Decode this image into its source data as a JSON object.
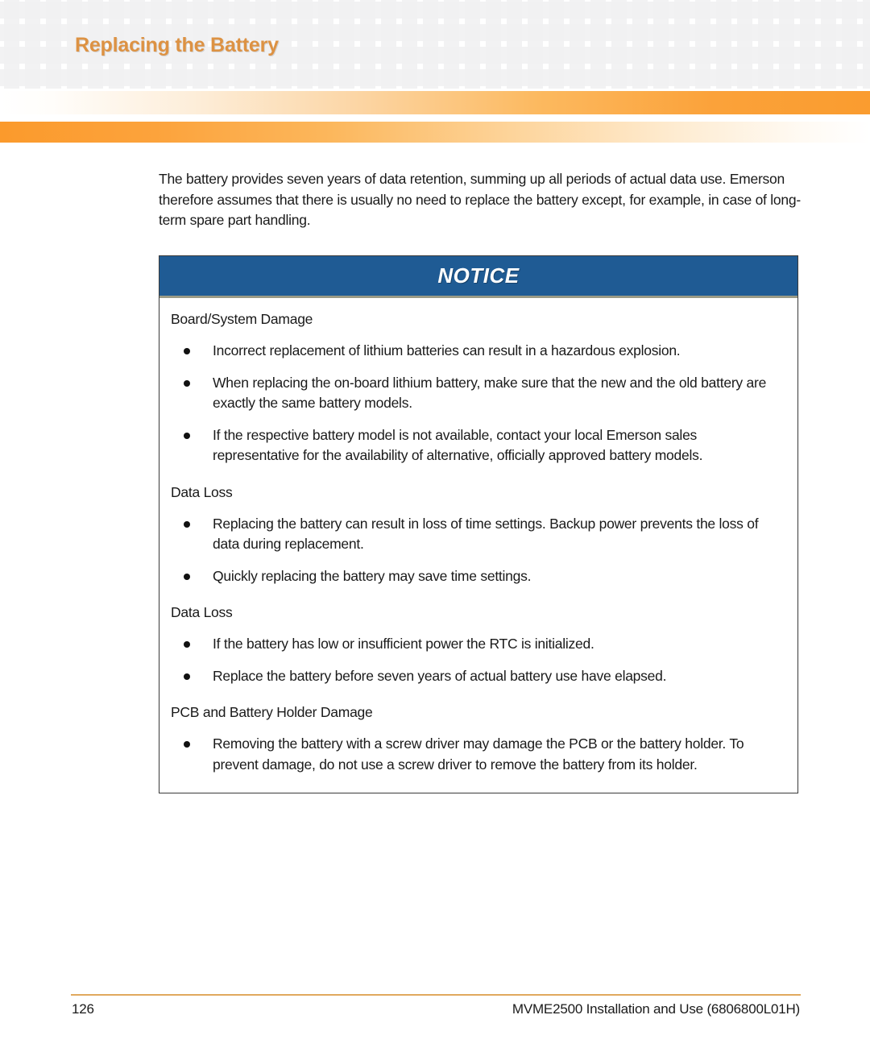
{
  "header": {
    "title": "Replacing the Battery",
    "title_color": "#dd9243",
    "accent_bar_color": "#fb9a2c"
  },
  "intro": {
    "paragraph": "The battery provides seven years of data retention, summing up all periods of actual data use. Emerson therefore assumes that there is usually no need to replace the battery except, for example, in case of long-term spare part handling."
  },
  "notice": {
    "title": "NOTICE",
    "header_color": "#1f5b94",
    "sections": [
      {
        "heading": "Board/System Damage",
        "items": [
          "Incorrect replacement of lithium batteries can result in a hazardous explosion.",
          "When replacing the on-board lithium battery, make sure that the new and the old battery are exactly the same battery models.",
          "If the respective battery model is not available, contact your local Emerson sales representative for the availability of alternative, officially approved battery models."
        ]
      },
      {
        "heading": "Data Loss",
        "items": [
          "Replacing the battery can result in loss of time settings. Backup power prevents the loss of data during replacement.",
          "Quickly replacing the battery may save time settings."
        ]
      },
      {
        "heading": "Data Loss",
        "items": [
          "If the battery has low or insufficient power the RTC is initialized.",
          "Replace the battery before seven years of actual battery use have elapsed."
        ]
      },
      {
        "heading": "PCB and Battery Holder Damage",
        "items": [
          "Removing the battery with a screw driver may damage the PCB or the battery holder. To prevent damage, do not use a screw driver to remove the battery from its holder."
        ]
      }
    ]
  },
  "footer": {
    "page_number": "126",
    "document": "MVME2500 Installation and Use (6806800L01H)",
    "rule_color": "#e0a95e"
  }
}
